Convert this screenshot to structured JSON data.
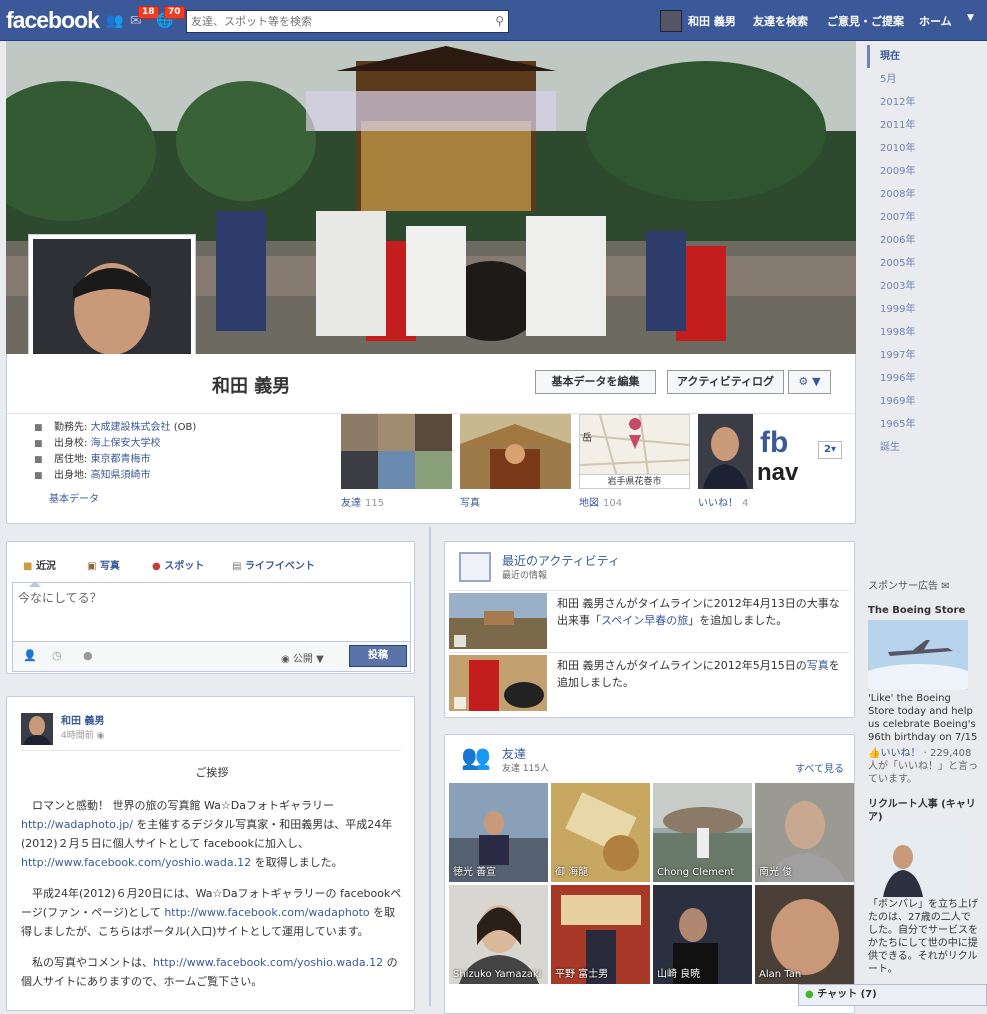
{
  "topbar": {
    "logo": "facebook",
    "friend_requests_count": "18",
    "messages_count": "70",
    "search_placeholder": "友達、スポット等を検索",
    "user_name": "和田 義男",
    "find_friends": "友達を検索",
    "feedback": "ご意見・ご提案",
    "home": "ホーム"
  },
  "profile": {
    "name": "和田 義男",
    "edit_button": "基本データを編集",
    "activity_log_button": "アクティビティログ",
    "info": [
      {
        "label": "勤務先:",
        "value": "大成建設株式会社",
        "suffix": " (OB)"
      },
      {
        "label": "出身校:",
        "value": "海上保安大学校"
      },
      {
        "label": "居住地:",
        "value": "東京都青梅市"
      },
      {
        "label": "出身地:",
        "value": "高知県須崎市"
      }
    ],
    "info_link": "基本データ",
    "thumbs": [
      {
        "label": "友達",
        "count": "115"
      },
      {
        "label": "写真",
        "count": ""
      },
      {
        "label": "地図",
        "count": "104"
      },
      {
        "label": "いいね！",
        "count": "4"
      }
    ],
    "map_place": "岩手県花巻市",
    "map_label_top": "岳",
    "more_count": "2"
  },
  "timeline_nav": [
    "現在",
    "5月",
    "2012年",
    "2011年",
    "2010年",
    "2009年",
    "2008年",
    "2007年",
    "2006年",
    "2005年",
    "2003年",
    "1999年",
    "1998年",
    "1997年",
    "1996年",
    "1969年",
    "1965年",
    "誕生"
  ],
  "composer": {
    "tabs": [
      "近況",
      "写真",
      "スポット",
      "ライフイベント"
    ],
    "placeholder": "今なにしてる？",
    "privacy": "公開",
    "post_button": "投稿"
  },
  "post": {
    "author": "和田 義男",
    "time": "4時間前",
    "heading": "ご挨拶",
    "p1a": "ロマンと感動！ 世界の旅の写真館 Wa☆Daフォトギャラリー",
    "p1_link1": "http://wadaphoto.jp/",
    "p1b": " を主催するデジタル写真家・和田義男は、平成24年(2012)２月５日に個人サイトとして facebookに加入し、",
    "p1_link2": "http://www.facebook.com/yoshio.wada.12",
    "p1c": " を取得しました。",
    "p2a": "平成24年(2012)６月20日には、Wa☆Daフォトギャラリーの facebookページ(ファン・ページ)として ",
    "p2_link": "http://www.facebook.com/wadaphoto",
    "p2b": " を取得しましたが、こちらはポータル(入口)サイトとして運用しています。",
    "p3a": "私の写真やコメントは、",
    "p3_link": "http://www.facebook.com/yoshio.wada.12",
    "p3b": " の個人サイトにありますので、ホームご覧下さい。"
  },
  "activity": {
    "title": "最近のアクティビティ",
    "subtitle": "最近の情報",
    "items": [
      {
        "pre": "和田 義男さんがタイムラインに2012年4月13日の大事な出来事「",
        "link": "スペイン早春の旅",
        "post": "」を追加しました。"
      },
      {
        "pre": "和田 義男さんがタイムラインに2012年5月15日の",
        "link": "写真",
        "post": "を追加しました。"
      }
    ]
  },
  "friends": {
    "title": "友達",
    "count": "友達 115人",
    "see_all": "すべて見る",
    "list": [
      "徳光 善宣",
      "御 海龍",
      "Chong Clement",
      "南光 俊",
      "Shizuko Yamazaki",
      "平野 富士男",
      "山崎 良暁",
      "Alan Tan"
    ]
  },
  "ads": {
    "header": "スポンサー広告",
    "ad1_title": "The Boeing Store",
    "ad1_text": "'Like' the Boeing Store today and help us celebrate Boeing's 96th birthday on 7/15",
    "ad1_like": "いいね！",
    "ad1_like_count": " · 229,408人が「いいね！」と言っています。",
    "ad2_title": "リクルート人事 (キャリア)",
    "ad2_text": "「ボンバレ」を立ち上げたのは、27歳の二人でした。自分でサービスをかたちにして世の中に提供できる。それがリクルート。"
  },
  "chat": {
    "label": "チャット",
    "count": "(7)"
  },
  "colors": {
    "brand": "#3b5998",
    "badge": "#f03d25"
  }
}
